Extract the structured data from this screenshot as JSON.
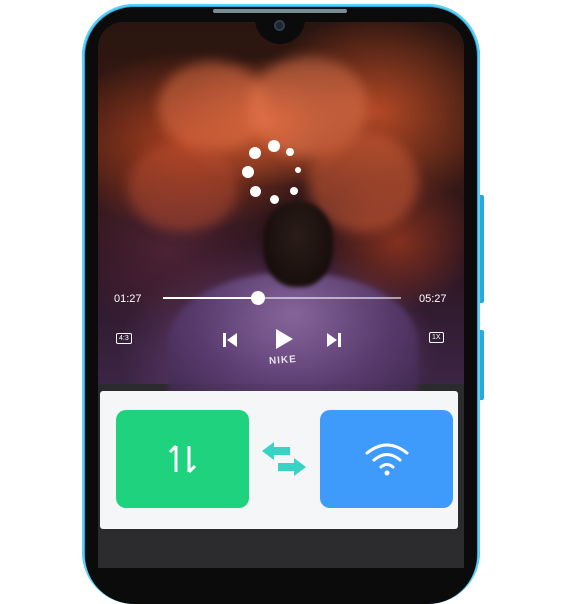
{
  "player": {
    "elapsed_time": "01:27",
    "total_time": "05:27",
    "progress": 0.4,
    "aspect_label": "4:3",
    "speed_label": "1X",
    "shirt_text": "NIKE"
  },
  "transfer": {
    "left_tile_icon": "data-transfer-icon",
    "middle_icon": "swap-arrows-icon",
    "right_tile_icon": "wifi-icon",
    "colors": {
      "green": "#1ed27e",
      "blue": "#3f9bfb",
      "arrow": "#37d3c4"
    }
  }
}
